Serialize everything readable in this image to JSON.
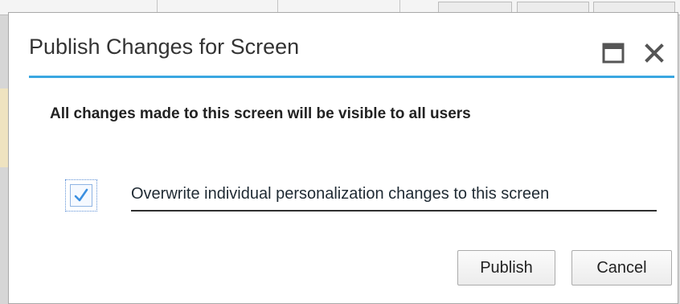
{
  "dialog": {
    "title": "Publish Changes for Screen",
    "message": "All changes made to this screen will be visible to all users",
    "checkbox": {
      "label": "Overwrite individual personalization changes to this screen",
      "checked": true
    },
    "buttons": {
      "publish": "Publish",
      "cancel": "Cancel"
    },
    "icons": {
      "maximize": "maximize-icon",
      "close": "close-icon",
      "check": "checkmark-icon"
    },
    "colors": {
      "accent": "#3aa7e1",
      "checkmark": "#3a8fe0"
    }
  }
}
